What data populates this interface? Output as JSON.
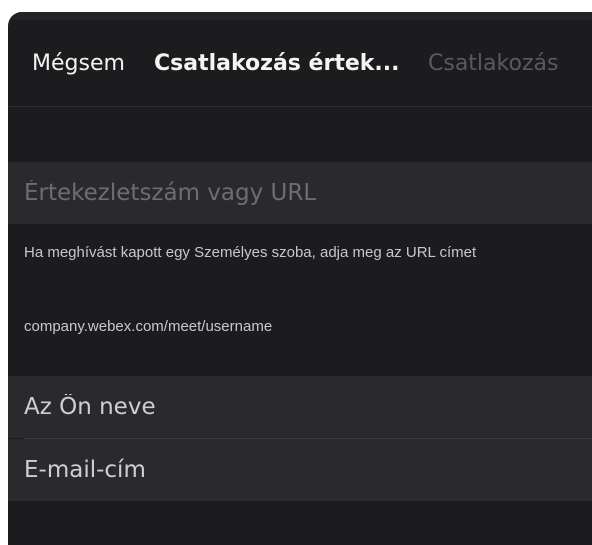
{
  "nav": {
    "cancel_label": "Mégsem",
    "title": "Csatlakozás értek...",
    "join_label": "Csatlakozás"
  },
  "meeting": {
    "placeholder": "Értekezletszám vagy URL",
    "hint": "Ha meghívást kapott egy Személyes szoba, adja meg az URL címet",
    "example": "company.webex.com/meet/username"
  },
  "identity": {
    "name_placeholder": "Az Ön neve",
    "email_placeholder": "E-mail-cím"
  },
  "colors": {
    "background": "#1c1c1e",
    "field": "#2a2a2d",
    "disabled_text": "#5a5a5e"
  }
}
